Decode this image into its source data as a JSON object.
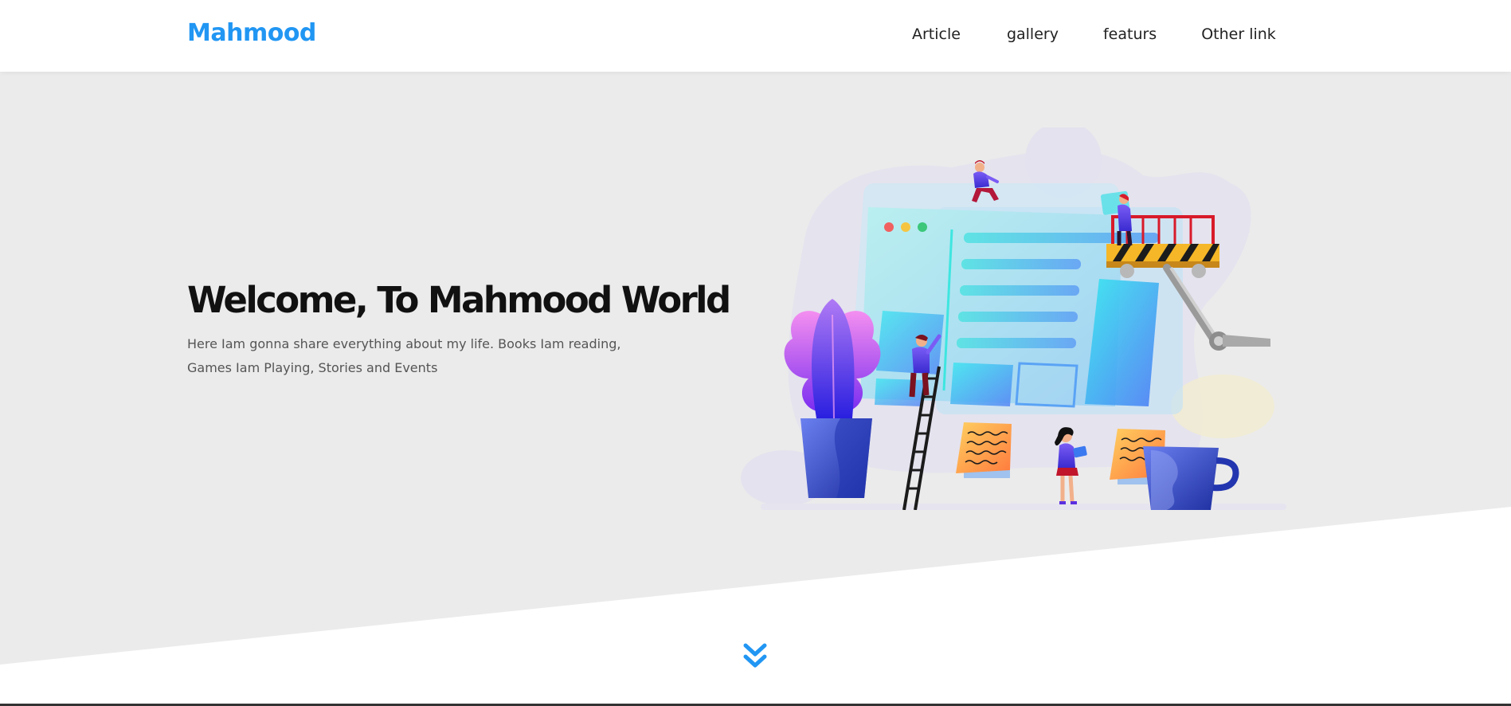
{
  "header": {
    "logo": "Mahmood",
    "nav": [
      {
        "label": "Article"
      },
      {
        "label": "gallery"
      },
      {
        "label": "featurs"
      },
      {
        "label": "Other link"
      }
    ]
  },
  "hero": {
    "title": "Welcome, To Mahmood World",
    "subtitle": "Here Iam gonna share everything about my life. Books Iam reading, Games Iam Playing, Stories and Events"
  },
  "icons": {
    "scroll": "double-chevron-down-icon"
  },
  "colors": {
    "accent": "#2196f3",
    "hero_bg": "#ebebeb",
    "title": "#111111",
    "text": "#555555"
  }
}
